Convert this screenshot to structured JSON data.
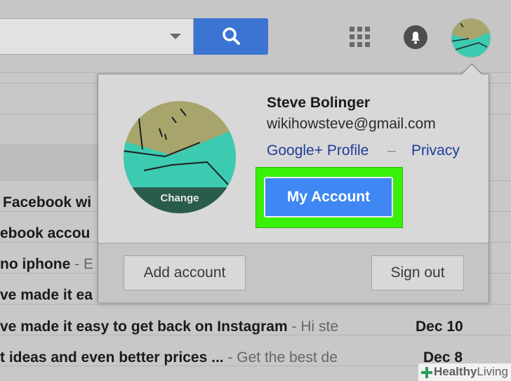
{
  "colors": {
    "search_button": "#3b74d3",
    "link": "#1d3d9a",
    "my_account_button": "#3f87f2",
    "highlight": "#39f007",
    "avatar_teal": "#3ccab0",
    "avatar_khaki": "#a8a56c",
    "avatar_dark": "#2a5c4c"
  },
  "toolbar": {
    "dropdown_icon": "chevron-down-icon",
    "search_icon": "search-icon",
    "apps_icon": "apps-grid-icon",
    "notifications_icon": "bell-icon",
    "avatar_icon": "avatar"
  },
  "account_popup": {
    "name": "Steve Bolinger",
    "email": "wikihowsteve@gmail.com",
    "profile_link": "Google+ Profile",
    "separator": "–",
    "privacy_link": "Privacy",
    "change_label": "Change",
    "my_account_label": "My Account",
    "add_account_label": "Add account",
    "sign_out_label": "Sign out"
  },
  "mail_rows": [
    {
      "sender": "Facebook wi",
      "snippet": "",
      "date": ""
    },
    {
      "sender": "ebook accou",
      "snippet": "",
      "date": ""
    },
    {
      "sender": "no iphone",
      "snippet": " - E",
      "date": ""
    },
    {
      "sender": "ve made it ea",
      "snippet": "",
      "date": ""
    },
    {
      "sender": "ve made it easy to get back on Instagram",
      "snippet": " - Hi ste",
      "date": "Dec 10"
    },
    {
      "sender": "t ideas and even better prices ...",
      "snippet": " - Get the best de",
      "date": "Dec 8"
    }
  ],
  "watermark": {
    "brand": "Healthy",
    "suffix": "Living"
  }
}
